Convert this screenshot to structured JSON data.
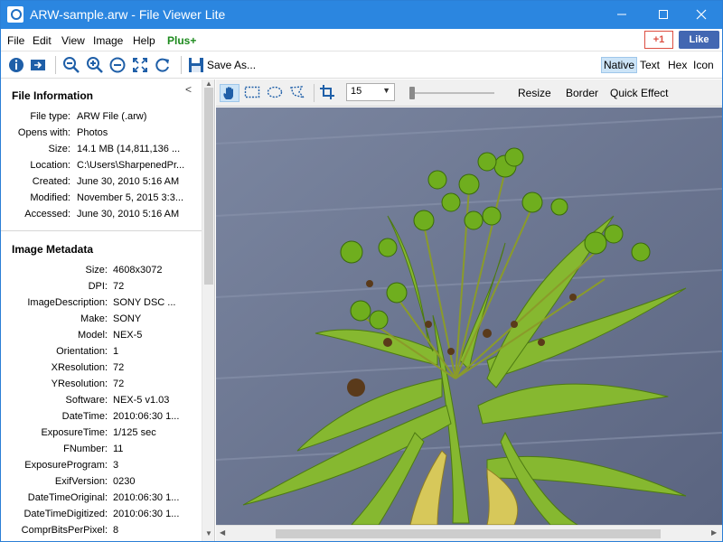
{
  "window": {
    "title": "ARW-sample.arw - File Viewer Lite",
    "minimize": "—",
    "maximize": "☐",
    "close": "✕"
  },
  "menu": [
    "File",
    "Edit",
    "View",
    "Image",
    "Help",
    "Plus+"
  ],
  "social": {
    "gplus": "+1",
    "fblike": "Like"
  },
  "toolbar": {
    "save_as": "Save As...",
    "view_tabs": [
      "Native",
      "Text",
      "Hex",
      "Icon"
    ],
    "active_view": "Native"
  },
  "file_info": {
    "heading": "File Information",
    "rows": [
      {
        "k": "File type:",
        "v": "ARW File (.arw)"
      },
      {
        "k": "Opens with:",
        "v": "Photos"
      },
      {
        "k": "Size:",
        "v": "14.1 MB (14,811,136 ..."
      },
      {
        "k": "Location:",
        "v": "C:\\Users\\SharpenedPr..."
      },
      {
        "k": "Created:",
        "v": "June 30, 2010 5:16 AM"
      },
      {
        "k": "Modified:",
        "v": "November 5, 2015 3:3..."
      },
      {
        "k": "Accessed:",
        "v": "June 30, 2010 5:16 AM"
      }
    ]
  },
  "metadata": {
    "heading": "Image Metadata",
    "rows": [
      {
        "k": "Size:",
        "v": "4608x3072"
      },
      {
        "k": "DPI:",
        "v": "72"
      },
      {
        "k": "ImageDescription:",
        "v": "SONY DSC        ..."
      },
      {
        "k": "Make:",
        "v": "SONY"
      },
      {
        "k": "Model:",
        "v": "NEX-5"
      },
      {
        "k": "Orientation:",
        "v": "1"
      },
      {
        "k": "XResolution:",
        "v": "72"
      },
      {
        "k": "YResolution:",
        "v": "72"
      },
      {
        "k": "Software:",
        "v": "NEX-5 v1.03"
      },
      {
        "k": "DateTime:",
        "v": "2010:06:30 1..."
      },
      {
        "k": "ExposureTime:",
        "v": "1/125 sec"
      },
      {
        "k": "FNumber:",
        "v": "11"
      },
      {
        "k": "ExposureProgram:",
        "v": "3"
      },
      {
        "k": "ExifVersion:",
        "v": "0230"
      },
      {
        "k": "DateTimeOriginal:",
        "v": "2010:06:30 1..."
      },
      {
        "k": "DateTimeDigitized:",
        "v": "2010:06:30 1..."
      },
      {
        "k": "ComprBitsPerPixel:",
        "v": "8"
      }
    ]
  },
  "image_toolbar": {
    "zoom_value": "15",
    "resize": "Resize",
    "border": "Border",
    "quick_effect": "Quick Effect"
  },
  "colors": {
    "titlebar": "#2b86e0",
    "accent": "#1d8a1d",
    "backdrop": "#6d7791",
    "leaf": "#7fb22b"
  },
  "icons": [
    "info-icon",
    "open-icon",
    "zoom-out-icon",
    "zoom-in-icon",
    "zoom-reset-icon",
    "fit-icon",
    "rotate-icon",
    "save-icon",
    "hand-icon",
    "rect-select-icon",
    "ellipse-select-icon",
    "lasso-icon",
    "crop-icon"
  ]
}
